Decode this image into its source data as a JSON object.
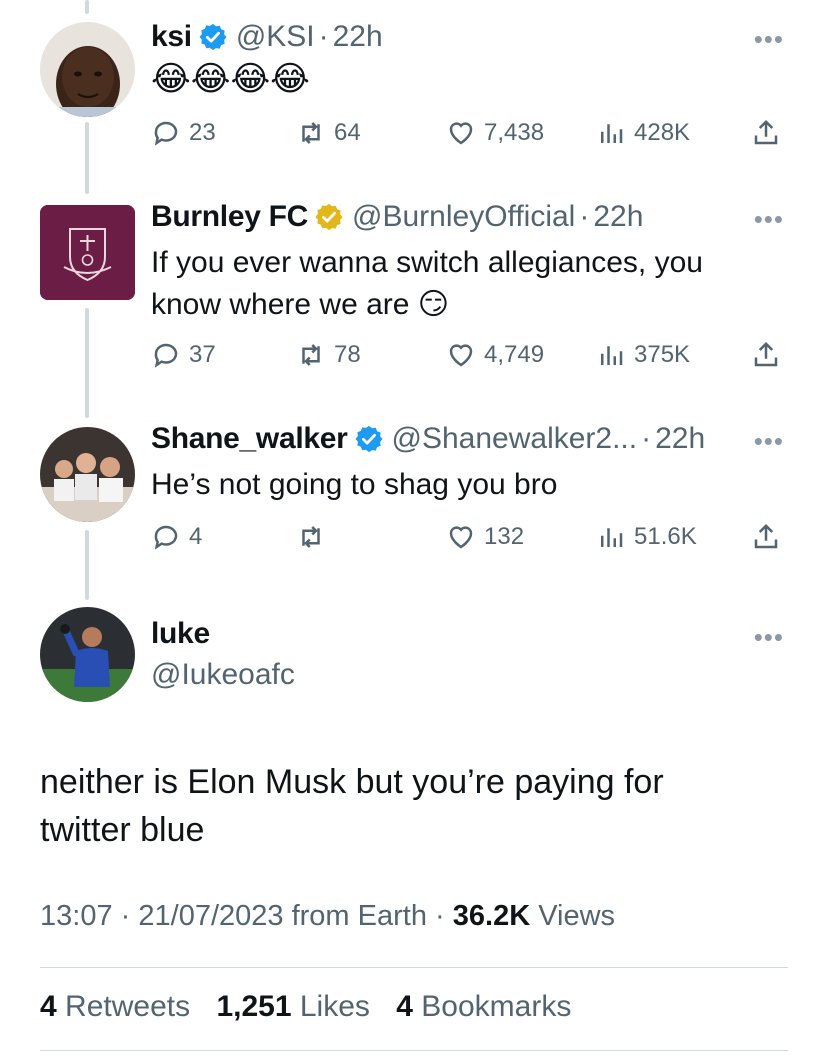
{
  "tweets": [
    {
      "name": "ksi",
      "handle": "@KSI",
      "time": "22h",
      "text": "😂😂😂😂",
      "replies": "23",
      "retweets": "64",
      "likes": "7,438",
      "views": "428K",
      "verified_color": "#1d9bf0"
    },
    {
      "name": "Burnley FC",
      "handle": "@BurnleyOfficial",
      "time": "22h",
      "text": "If you ever wanna switch allegiances, you know where we are 😏",
      "replies": "37",
      "retweets": "78",
      "likes": "4,749",
      "views": "375K",
      "verified_color": "#e2b719"
    },
    {
      "name": "Shane_walker",
      "handle": "@Shanewalker2...",
      "time": "22h",
      "text": "He’s not going to shag you bro",
      "replies": "4",
      "retweets": "",
      "likes": "132",
      "views": "51.6K",
      "verified_color": "#1d9bf0"
    }
  ],
  "main_tweet": {
    "name": "luke",
    "handle": "@Iukeoafc",
    "text": "neither is Elon Musk but you’re paying for twitter blue",
    "time": "13:07",
    "date": "21/07/2023",
    "source": "from Earth",
    "views_count": "36.2K",
    "views_label": "Views",
    "retweets_count": "4",
    "retweets_label": "Retweets",
    "likes_count": "1,251",
    "likes_label": "Likes",
    "bookmarks_count": "4",
    "bookmarks_label": "Bookmarks"
  },
  "more_glyph": "•••",
  "separator": "·"
}
